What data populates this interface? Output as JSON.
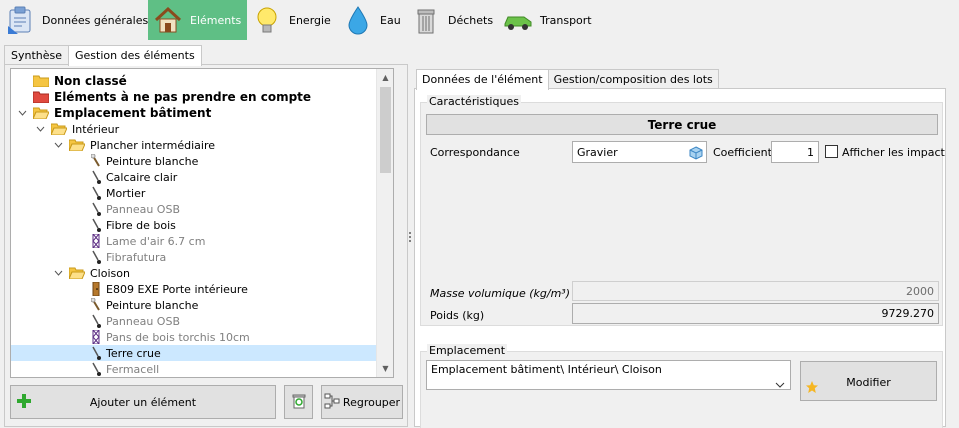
{
  "topbar": {
    "tabs": [
      {
        "label": "Données générales",
        "icon": "clipboard-icon"
      },
      {
        "label": "Eléments",
        "icon": "house-icon",
        "active": true
      },
      {
        "label": "Energie",
        "icon": "lightbulb-icon"
      },
      {
        "label": "Eau",
        "icon": "water-drop-icon"
      },
      {
        "label": "Déchets",
        "icon": "trash-bin-icon"
      },
      {
        "label": "Transport",
        "icon": "car-icon"
      }
    ],
    "active_color": "#5fbf85"
  },
  "subtabs": [
    "Synthèse",
    "Gestion des éléments"
  ],
  "tree": {
    "nodes": [
      {
        "label": "Non classé"
      },
      {
        "label": "Eléments à ne pas prendre en compte"
      },
      {
        "label": "Emplacement bâtiment"
      },
      {
        "label": "Intérieur"
      },
      {
        "label": "Plancher intermédiaire"
      },
      {
        "label": "Peinture blanche"
      },
      {
        "label": "Calcaire clair"
      },
      {
        "label": "Mortier"
      },
      {
        "label": "Panneau OSB"
      },
      {
        "label": "Fibre de bois"
      },
      {
        "label": "Lame d'air 6.7 cm"
      },
      {
        "label": "Fibrafutura"
      },
      {
        "label": "Cloison"
      },
      {
        "label": "E809 EXE Porte intérieure"
      },
      {
        "label": "Peinture blanche"
      },
      {
        "label": "Panneau OSB"
      },
      {
        "label": "Pans de bois torchis 10cm"
      },
      {
        "label": "Terre crue"
      },
      {
        "label": "Fermacell"
      }
    ]
  },
  "buttons": {
    "add": "Ajouter un élément",
    "group": "Regrouper"
  },
  "right": {
    "tabs": [
      "Données de l'élément",
      "Gestion/composition des lots"
    ],
    "caracteristiques": {
      "title": "Caractéristiques",
      "element_name": "Terre crue",
      "correspondance_label": "Correspondance",
      "correspondance_value": "Gravier",
      "coefficient_label": "Coefficient",
      "coefficient_value": "1",
      "afficher_label": "Afficher les impact",
      "masse_label": "Masse volumique (kg/m³)",
      "masse_value": "2000",
      "poids_label": "Poids (kg)",
      "poids_value": "9729.270"
    },
    "emplacement": {
      "title": "Emplacement",
      "value": "Emplacement bâtiment\\ Intérieur\\ Cloison",
      "modifier": "Modifier"
    }
  }
}
